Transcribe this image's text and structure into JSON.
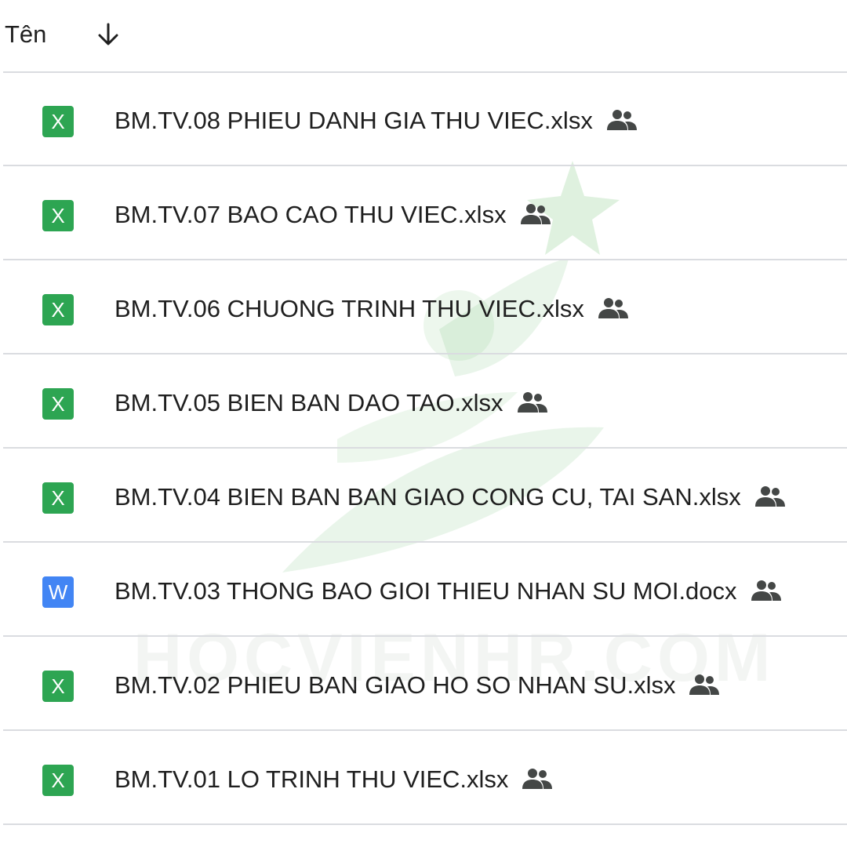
{
  "header": {
    "column_label": "Tên",
    "sort_icon": "arrow-down-icon"
  },
  "files": [
    {
      "name": "BM.TV.08 PHIEU DANH GIA THU VIEC.xlsx",
      "type": "xlsx",
      "icon_letter": "X",
      "shared": true
    },
    {
      "name": "BM.TV.07 BAO CAO THU VIEC.xlsx",
      "type": "xlsx",
      "icon_letter": "X",
      "shared": true
    },
    {
      "name": "BM.TV.06 CHUONG TRINH THU VIEC.xlsx",
      "type": "xlsx",
      "icon_letter": "X",
      "shared": true
    },
    {
      "name": "BM.TV.05 BIEN BAN DAO TAO.xlsx",
      "type": "xlsx",
      "icon_letter": "X",
      "shared": true
    },
    {
      "name": "BM.TV.04 BIEN BAN BAN GIAO CONG CU, TAI SAN.xlsx",
      "type": "xlsx",
      "icon_letter": "X",
      "shared": true
    },
    {
      "name": "BM.TV.03 THONG BAO GIOI THIEU NHAN SU MOI.docx",
      "type": "docx",
      "icon_letter": "W",
      "shared": true
    },
    {
      "name": "BM.TV.02 PHIEU BAN GIAO HO SO NHAN SU.xlsx",
      "type": "xlsx",
      "icon_letter": "X",
      "shared": true
    },
    {
      "name": "BM.TV.01 LO TRINH THU VIEC.xlsx",
      "type": "xlsx",
      "icon_letter": "X",
      "shared": true
    }
  ],
  "watermark": {
    "text": "HOCVIENHR.COM"
  },
  "colors": {
    "xlsx_icon": "#2da552",
    "docx_icon": "#4285f4",
    "divider": "#dadce0",
    "text": "#1f1f1f",
    "shared_icon": "#444746"
  }
}
